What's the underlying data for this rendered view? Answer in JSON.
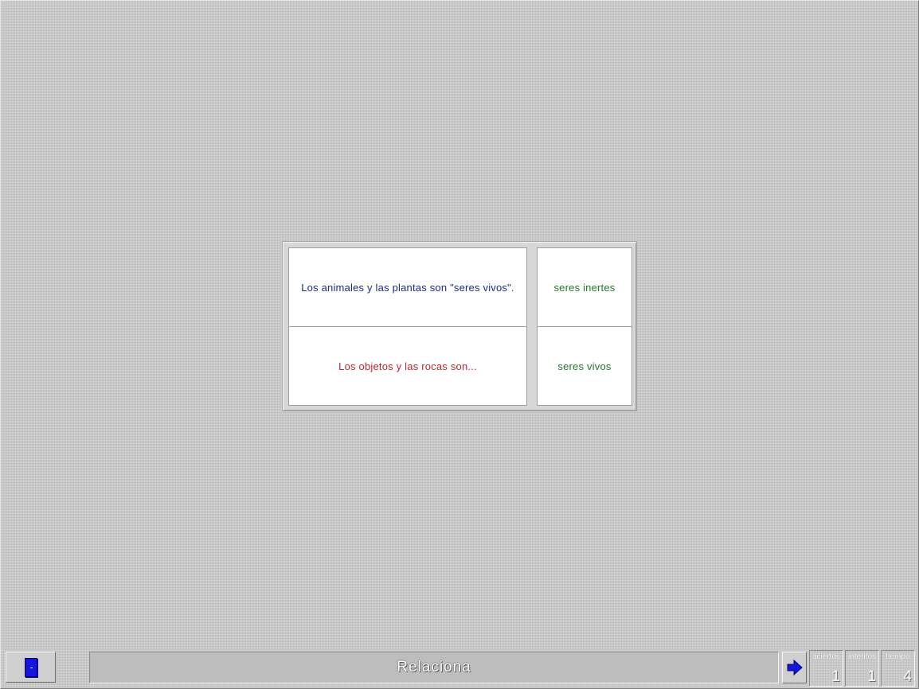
{
  "activity": {
    "questions": [
      {
        "text": "Los animales y las plantas son  \"seres vivos\"."
      },
      {
        "text": "Los objetos y las rocas son..."
      }
    ],
    "answers": [
      {
        "text": "seres inertes"
      },
      {
        "text": "seres vivos"
      }
    ]
  },
  "statusbar": {
    "title": "Relaciona",
    "exit_icon": "door-icon",
    "next_icon": "arrow-right-icon",
    "counters": [
      {
        "label": "aciertos",
        "value": "1"
      },
      {
        "label": "intentos",
        "value": "1"
      },
      {
        "label": "tiempo",
        "value": "4"
      }
    ]
  },
  "colors": {
    "background": "#c9c9c9",
    "question_1_text": "#1b2a8f",
    "question_2_text": "#c0262b",
    "answer_text": "#1f7a28",
    "icon_blue": "#1515e0"
  }
}
